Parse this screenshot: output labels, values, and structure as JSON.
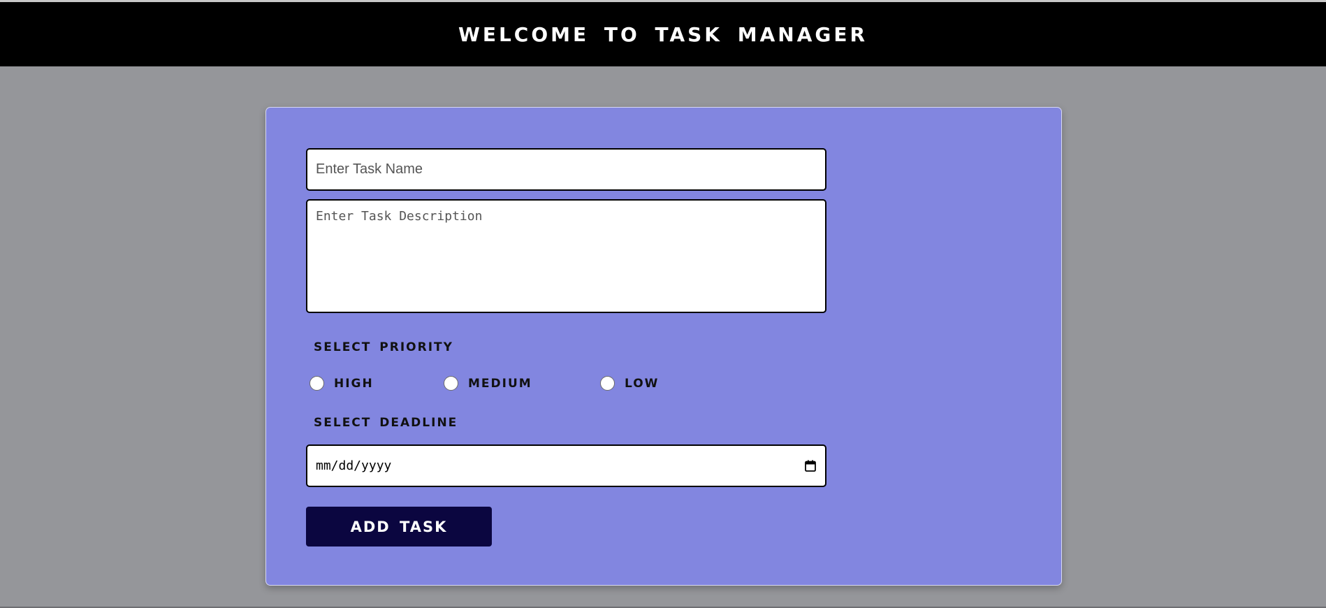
{
  "header": {
    "title": "WELCOME TO TASK MANAGER"
  },
  "form": {
    "task_name_placeholder": "Enter Task Name",
    "task_description_placeholder": "Enter Task Description",
    "priority_label": "SELECT PRIORITY",
    "priority_options": [
      {
        "label": "HIGH"
      },
      {
        "label": "MEDIUM"
      },
      {
        "label": "LOW"
      }
    ],
    "deadline_label": "SELECT DEADLINE",
    "deadline_placeholder": "mm/dd/yyyy",
    "add_button_label": "ADD TASK"
  },
  "icons": {
    "calendar": "calendar-icon"
  },
  "colors": {
    "page_background": "#95969a",
    "header_background": "#000000",
    "card_background": "#8286e0",
    "button_background": "#0b0640"
  }
}
